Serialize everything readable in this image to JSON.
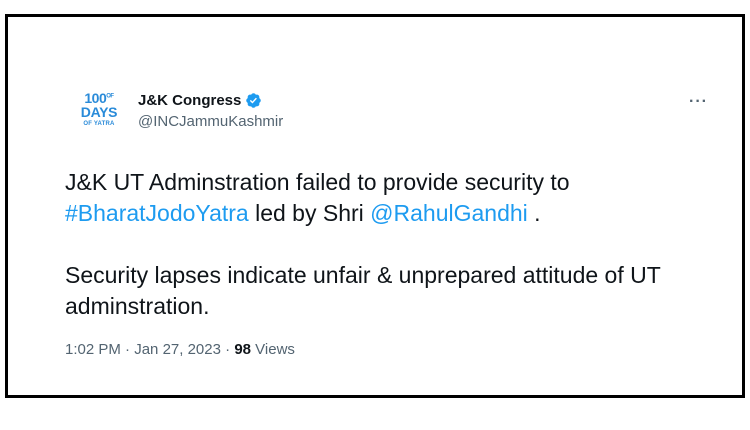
{
  "account": {
    "avatar_line1": "100",
    "avatar_line1_small": "OF",
    "avatar_line2": "DAYS",
    "avatar_line3": "OF YATRA",
    "display_name": "J&K Congress",
    "handle": "@INCJammuKashmir",
    "verified_icon": "verified-badge-icon",
    "verified_color": "#1d9bf0"
  },
  "more_icon": "···",
  "tweet": {
    "p1_before_hashtag": "J&K UT Adminstration failed to provide security to",
    "hashtag": "#BharatJodoYatra",
    "p1_middle": " led by Shri ",
    "mention": "@RahulGandhi",
    "p1_after": " .",
    "p2": "Security lapses indicate unfair & unprepared attitude of UT adminstration."
  },
  "meta": {
    "time": "1:02 PM",
    "sep1": " · ",
    "date": "Jan 27, 2023",
    "sep2": " · ",
    "views_count": "98",
    "views_label": " Views"
  },
  "colors": {
    "link": "#1d9bf0",
    "muted": "#536471",
    "text": "#0f1419",
    "frame_border": "#000000"
  }
}
